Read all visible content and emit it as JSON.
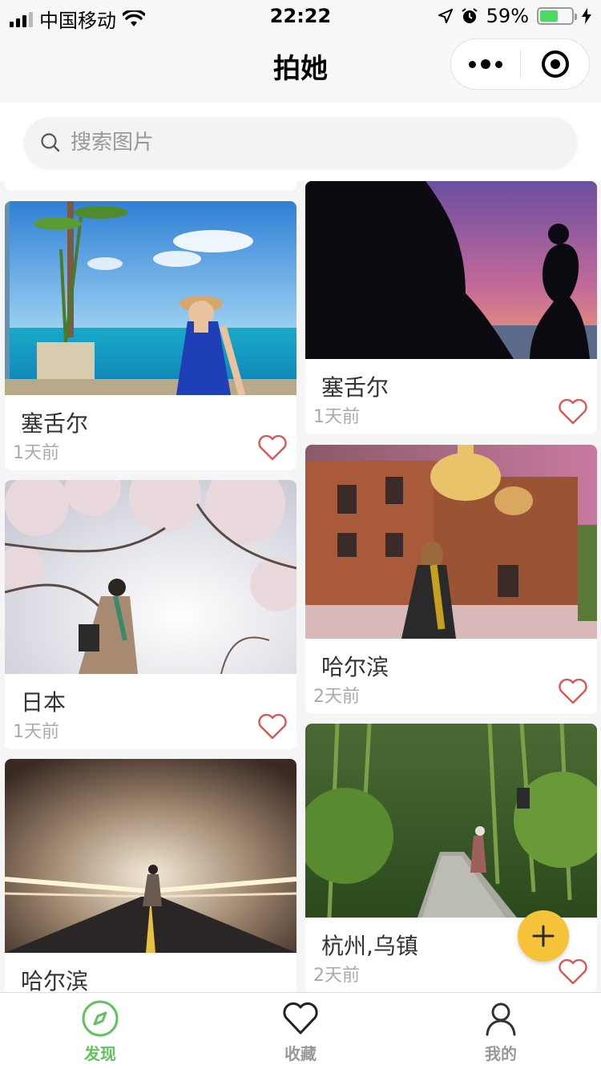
{
  "status_bar": {
    "carrier": "中国移动",
    "time": "22:22",
    "battery_percent": "59%",
    "battery_level": 0.59,
    "battery_color": "#4cd964"
  },
  "nav": {
    "title": "拍她",
    "more_icon": "more-dots-icon",
    "close_icon": "target-close-icon"
  },
  "search": {
    "placeholder": "搜索图片",
    "value": ""
  },
  "cards": [
    {
      "location": "塞舌尔",
      "time": "1天前",
      "liked": false,
      "scene": "sea-balcony-woman"
    },
    {
      "location": "塞舌尔",
      "time": "1天前",
      "liked": false,
      "scene": "sunset-silhouette"
    },
    {
      "location": "日本",
      "time": "1天前",
      "liked": false,
      "scene": "cherry-blossom-woman"
    },
    {
      "location": "哈尔滨",
      "time": "2天前",
      "liked": false,
      "scene": "cathedral-night-woman"
    },
    {
      "location": "哈尔滨",
      "time": "",
      "liked": false,
      "scene": "tunnel-lights-woman"
    },
    {
      "location": "杭州,乌镇",
      "time": "2天前",
      "liked": false,
      "scene": "bamboo-forest-path"
    }
  ],
  "fab": {
    "icon": "plus-icon",
    "color": "#f5c23a"
  },
  "tabbar": {
    "tabs": [
      {
        "label": "发现",
        "icon": "compass-icon",
        "active": true
      },
      {
        "label": "收藏",
        "icon": "heart-outline-icon",
        "active": false
      },
      {
        "label": "我的",
        "icon": "user-icon",
        "active": false
      }
    ],
    "active_color": "#62c35d",
    "inactive_color": "#999999"
  },
  "colors": {
    "heart": "#e05555",
    "accent": "#62c35d"
  }
}
